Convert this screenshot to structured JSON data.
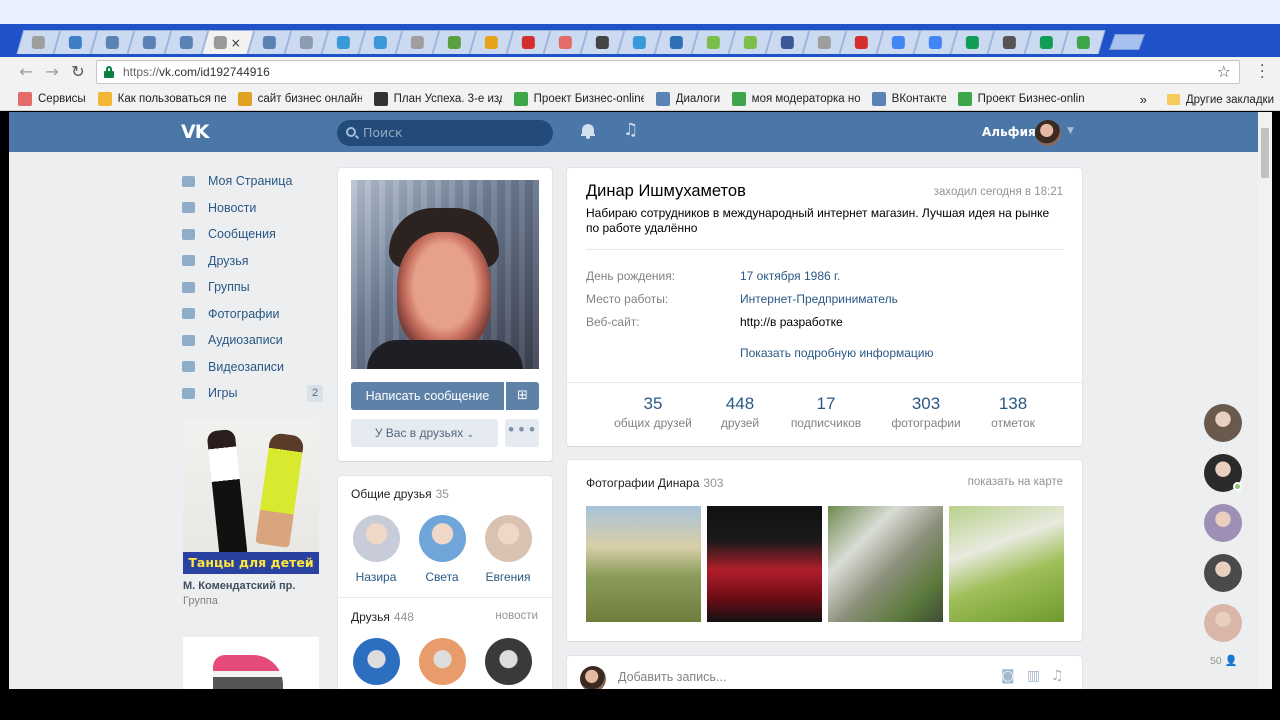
{
  "browser": {
    "tabs": [
      {
        "icon": "gmail-icon",
        "color": "#9e9e9e"
      },
      {
        "icon": "z-icon",
        "color": "#3f7ec5"
      },
      {
        "icon": "vk-icon",
        "color": "#5b82b5"
      },
      {
        "icon": "vk-icon",
        "color": "#5b82b5"
      },
      {
        "icon": "chat-icon",
        "color": "#5b82b5"
      },
      {
        "icon": "active-tab-icon",
        "color": "#999999",
        "active": true
      },
      {
        "icon": "vk-icon",
        "color": "#5b82b5"
      },
      {
        "icon": "vk-icon",
        "color": "#8b9bb0"
      },
      {
        "icon": "telegram-icon",
        "color": "#3a9ad9"
      },
      {
        "icon": "telegram-icon",
        "color": "#3a9ad9"
      },
      {
        "icon": "doc-icon",
        "color": "#9e9e9e"
      },
      {
        "icon": "folder-icon",
        "color": "#5aa043"
      },
      {
        "icon": "at-icon",
        "color": "#e6a21b"
      },
      {
        "icon": "opera-icon",
        "color": "#d32f2f"
      },
      {
        "icon": "apps-icon",
        "color": "#e56b6b"
      },
      {
        "icon": "rocket-icon",
        "color": "#444444"
      },
      {
        "icon": "telegram-icon",
        "color": "#3a9ad9"
      },
      {
        "icon": "fn-icon",
        "color": "#2f6fb5"
      },
      {
        "icon": "ok-icon",
        "color": "#7bbf4a"
      },
      {
        "icon": "ok-icon",
        "color": "#7bbf4a"
      },
      {
        "icon": "instagram-icon",
        "color": "#3b5998"
      },
      {
        "icon": "doc-icon",
        "color": "#9e9e9e"
      },
      {
        "icon": "youtube-icon",
        "color": "#d32f2f"
      },
      {
        "icon": "google-icon",
        "color": "#4285f4"
      },
      {
        "icon": "google-icon",
        "color": "#4285f4"
      },
      {
        "icon": "sheets-icon",
        "color": "#0f9d58"
      },
      {
        "icon": "eye-icon",
        "color": "#555555"
      },
      {
        "icon": "sheets-icon",
        "color": "#0f9d58"
      },
      {
        "icon": "drive-icon",
        "color": "#3ea64a"
      }
    ],
    "url_proto": "https://",
    "url_rest": "vk.com/id192744916",
    "bookmarks": [
      {
        "label": "Сервисы",
        "icon": "apps-icon",
        "color": "#e56b6b",
        "width": 70
      },
      {
        "label": "Как пользоваться пе",
        "icon": "star-bm-icon",
        "color": "#f2b632",
        "width": 128
      },
      {
        "label": "сайт бизнес онлайн",
        "icon": "face-icon",
        "color": "#e0a020",
        "width": 124
      },
      {
        "label": "План Успеха. 3-е изд",
        "icon": "circle-icon",
        "color": "#333333",
        "width": 128
      },
      {
        "label": "Проект Бизнес-online",
        "icon": "download-icon",
        "color": "#3ea64a",
        "width": 130
      },
      {
        "label": "Диалоги",
        "icon": "vk-icon",
        "color": "#5b82b5",
        "width": 64
      },
      {
        "label": "моя модераторка но",
        "icon": "download-icon",
        "color": "#3ea64a",
        "width": 128
      },
      {
        "label": "ВКонтакте",
        "icon": "vk-icon",
        "color": "#5b82b5",
        "width": 74
      },
      {
        "label": "Проект Бизнес-online",
        "icon": "download-icon",
        "color": "#3ea64a",
        "width": 126
      }
    ],
    "bookmarks_more": "»",
    "other_bookmarks": "Другие закладки"
  },
  "vk": {
    "logo": "VK",
    "search_placeholder": "Поиск",
    "user_name": "Альфия",
    "menu": [
      {
        "label": "Моя Страница",
        "icon": "home-icon"
      },
      {
        "label": "Новости",
        "icon": "news-icon"
      },
      {
        "label": "Сообщения",
        "icon": "messages-icon"
      },
      {
        "label": "Друзья",
        "icon": "friends-icon"
      },
      {
        "label": "Группы",
        "icon": "groups-icon"
      },
      {
        "label": "Фотографии",
        "icon": "camera-icon"
      },
      {
        "label": "Аудиозаписи",
        "icon": "music-icon"
      },
      {
        "label": "Видеозаписи",
        "icon": "video-icon"
      },
      {
        "label": "Игры",
        "icon": "gamepad-icon",
        "badge": "2"
      }
    ],
    "ad": {
      "banner": "Танцы для детей",
      "title": "М. Комендатский пр.",
      "subtitle": "Группа"
    },
    "profile": {
      "name": "Динар Ишмухаметов",
      "online": "заходил сегодня в 18:21",
      "status": "Набираю сотрудников в международный интернет магазин. Лучшая идея на рынке по работе удалённо",
      "rows": [
        {
          "label": "День рождения:",
          "value": "17 октября 1986 г.",
          "link": true
        },
        {
          "label": "Место работы:",
          "value": "Интернет-Предприниматель",
          "link": true
        },
        {
          "label": "Веб-сайт:",
          "value": "http://в разработке",
          "link": false
        }
      ],
      "show_more": "Показать подробную информацию",
      "counts": [
        {
          "num": "35",
          "label": "общих друзей"
        },
        {
          "num": "448",
          "label": "друзей"
        },
        {
          "num": "17",
          "label": "подписчиков"
        },
        {
          "num": "303",
          "label": "фотографии"
        },
        {
          "num": "138",
          "label": "отметок"
        }
      ],
      "btn_message": "Написать сообщение",
      "btn_friends": "У Вас в друзьях",
      "btn_more": "•••"
    },
    "mutual": {
      "title": "Общие друзья",
      "count": "35",
      "people": [
        {
          "name": "Назира",
          "color": "#c8ccd8"
        },
        {
          "name": "Света",
          "color": "#6fa5d8"
        },
        {
          "name": "Евгения",
          "color": "#d9c2b2"
        }
      ]
    },
    "friends": {
      "title": "Друзья",
      "count": "448",
      "link": "новости",
      "people": [
        {
          "color": "#2c6fc0"
        },
        {
          "color": "#e99c6b"
        },
        {
          "color": "#3a3a3a"
        }
      ]
    },
    "photos": {
      "title": "Фотографии Динара",
      "count": "303",
      "map_link": "показать на карте",
      "items": [
        {
          "bg": "linear-gradient(180deg,#a8c3d9 0%,#d8cfa8 35%,#8b9c5a 60%,#6f7d3c 100%)"
        },
        {
          "bg": "linear-gradient(180deg,#111 0%,#1a1a1a 30%,#b01e2b 55%,#6c0c15 80%,#111 100%)"
        },
        {
          "bg": "linear-gradient(135deg,#6e8b4f 0%,#d9dcd6 30%,#8b8f7a 55%,#5b7a3c 80%,#3e4a33 100%)"
        },
        {
          "bg": "linear-gradient(160deg,#b8d18a 0%,#e8eadf 35%,#9fbf5a 60%,#6f9a2e 100%)"
        }
      ]
    },
    "post_placeholder": "Добавить запись...",
    "fastchat": [
      {
        "color": "#6a5a4e"
      },
      {
        "color": "#2a2a2a",
        "online": true
      },
      {
        "color": "#9e8fb5"
      },
      {
        "color": "#4a4a4a"
      },
      {
        "color": "#d9b6a8"
      }
    ],
    "fastchat_count": "50"
  }
}
